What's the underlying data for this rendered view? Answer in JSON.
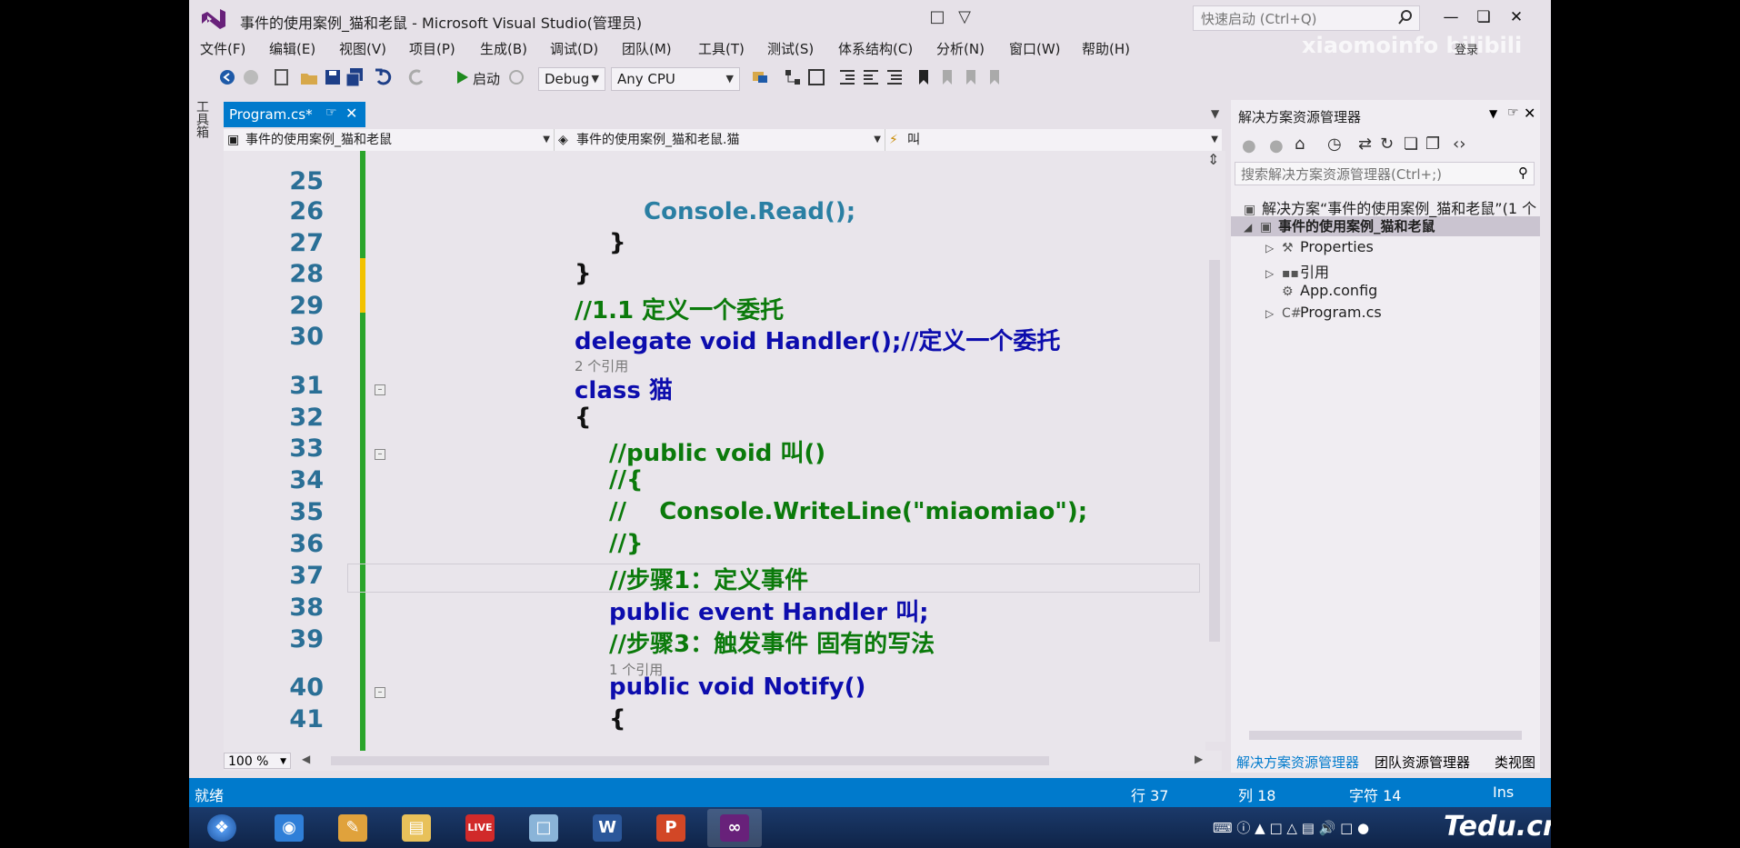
{
  "window": {
    "title": "事件的使用案例_猫和老鼠 - Microsoft Visual Studio(管理员)",
    "quick_launch_placeholder": "快速启动 (Ctrl+Q)",
    "signin": "登录",
    "watermark": "xiaomoinfo bilibili"
  },
  "menu": [
    "文件(F)",
    "编辑(E)",
    "视图(V)",
    "项目(P)",
    "生成(B)",
    "调试(D)",
    "团队(M)",
    "工具(T)",
    "测试(S)",
    "体系结构(C)",
    "分析(N)",
    "窗口(W)",
    "帮助(H)"
  ],
  "toolbar": {
    "start_label": "启动",
    "config": "Debug",
    "platform": "Any CPU"
  },
  "toolbox_label": "工具箱",
  "tab": {
    "label": "Program.cs*"
  },
  "navbar": {
    "project": "事件的使用案例_猫和老鼠",
    "class": "事件的使用案例_猫和老鼠.猫",
    "member": "叫"
  },
  "code_lines": [
    {
      "n": "25",
      "text": ""
    },
    {
      "n": "26",
      "text": "Console.Read();"
    },
    {
      "n": "27",
      "text": "}"
    },
    {
      "n": "28",
      "text": "}"
    },
    {
      "n": "29",
      "text": "//1.1 定义一个委托"
    },
    {
      "n": "30",
      "text": "delegate void Handler();//定义一个委托"
    },
    {
      "n": "31",
      "text": "class 猫"
    },
    {
      "n": "32",
      "text": "{"
    },
    {
      "n": "33",
      "text": "//public void 叫()"
    },
    {
      "n": "34",
      "text": "//{"
    },
    {
      "n": "35",
      "text": "//    Console.WriteLine(\"miaomiao\");"
    },
    {
      "n": "36",
      "text": "//}"
    },
    {
      "n": "37",
      "text": "//步骤1：定义事件"
    },
    {
      "n": "38",
      "text": "public event Handler 叫;"
    },
    {
      "n": "39",
      "text": "//步骤3：触发事件 固有的写法"
    },
    {
      "n": "40",
      "text": "public void Notify()"
    },
    {
      "n": "41",
      "text": "{"
    }
  ],
  "code_lens": {
    "class_refs": "2 个引用",
    "method_refs": "1 个引用"
  },
  "zoom": "100 %",
  "solution_explorer": {
    "title": "解决方案资源管理器",
    "search_placeholder": "搜索解决方案资源管理器(Ctrl+;)",
    "solution": "解决方案“事件的使用案例_猫和老鼠”(1 个",
    "project": "事件的使用案例_猫和老鼠",
    "items": [
      "Properties",
      "引用",
      "App.config",
      "Program.cs"
    ],
    "tabs": [
      "解决方案资源管理器",
      "团队资源管理器",
      "类视图"
    ]
  },
  "status": {
    "ready": "就绪",
    "line": "行 37",
    "col": "列 18",
    "char": "字符 14",
    "mode": "Ins"
  },
  "taskbar_brand": "Tedu.cn",
  "colors": {
    "accent": "#007acc",
    "keyword": "#0d0dad",
    "type": "#2a7fa3",
    "comment": "#0b7a0b"
  }
}
